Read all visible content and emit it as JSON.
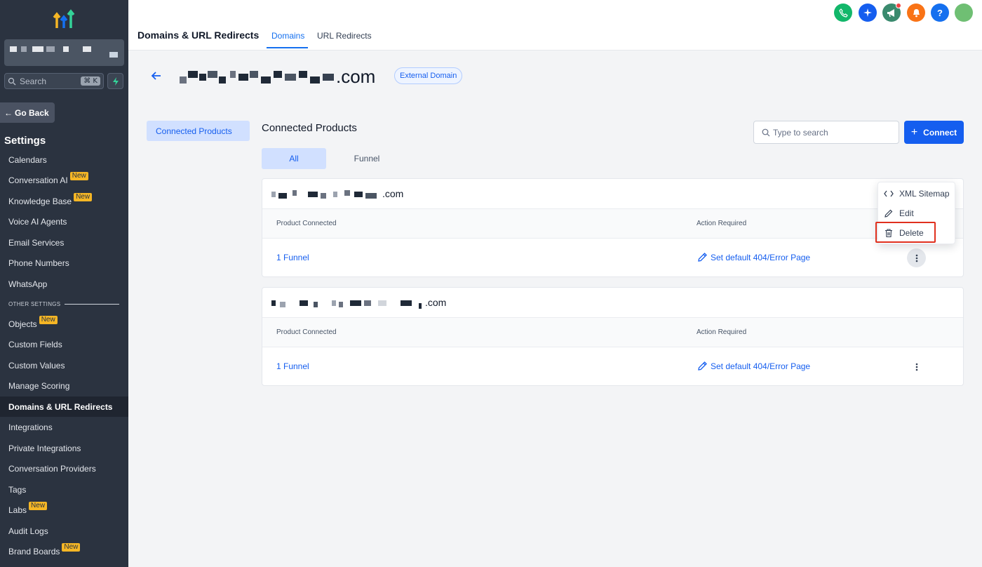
{
  "sidebar": {
    "search_placeholder": "Search",
    "search_shortcut": "⌘ K",
    "go_back": "Go Back",
    "heading": "Settings",
    "new_badge": "New",
    "other_settings": "OTHER SETTINGS",
    "items": [
      {
        "label": "Calendars",
        "new": false
      },
      {
        "label": "Conversation AI",
        "new": true
      },
      {
        "label": "Knowledge Base",
        "new": true
      },
      {
        "label": "Voice AI Agents",
        "new": false
      },
      {
        "label": "Email Services",
        "new": false
      },
      {
        "label": "Phone Numbers",
        "new": false
      },
      {
        "label": "WhatsApp",
        "new": false
      }
    ],
    "other_items": [
      {
        "label": "Objects",
        "new": true
      },
      {
        "label": "Custom Fields",
        "new": false
      },
      {
        "label": "Custom Values",
        "new": false
      },
      {
        "label": "Manage Scoring",
        "new": false
      },
      {
        "label": "Domains & URL Redirects",
        "new": false,
        "active": true
      },
      {
        "label": "Integrations",
        "new": false
      },
      {
        "label": "Private Integrations",
        "new": false
      },
      {
        "label": "Conversation Providers",
        "new": false
      },
      {
        "label": "Tags",
        "new": false
      },
      {
        "label": "Labs",
        "new": true
      },
      {
        "label": "Audit Logs",
        "new": false
      },
      {
        "label": "Brand Boards",
        "new": true
      }
    ]
  },
  "header": {
    "title": "Domains & URL Redirects",
    "tabs": [
      "Domains",
      "URL Redirects"
    ],
    "help_icon": "?",
    "icon_colors": {
      "phone": "#12b76a",
      "sparkle": "#155eef",
      "megaphone": "#3a8a6e",
      "bell": "#f97316",
      "help": "#1570ef",
      "avatar": "#6fbf73"
    }
  },
  "domain": {
    "suffix": ".com",
    "badge": "External Domain"
  },
  "left_nav": {
    "connected_products": "Connected Products"
  },
  "main": {
    "title": "Connected Products",
    "search_placeholder": "Type to search",
    "connect_plus": "+",
    "connect_label": "Connect",
    "filters": [
      "All",
      "Funnel"
    ],
    "cards": [
      {
        "domain_suffix": ".com",
        "col_product": "Product Connected",
        "col_action": "Action Required",
        "product": "1 Funnel",
        "action": "Set default 404/Error Page"
      },
      {
        "domain_suffix": ".com",
        "col_product": "Product Connected",
        "col_action": "Action Required",
        "product": "1 Funnel",
        "action": "Set default 404/Error Page"
      }
    ]
  },
  "dropdown": {
    "items": [
      "XML Sitemap",
      "Edit",
      "Delete"
    ],
    "highlight_color": "#e0301e"
  }
}
